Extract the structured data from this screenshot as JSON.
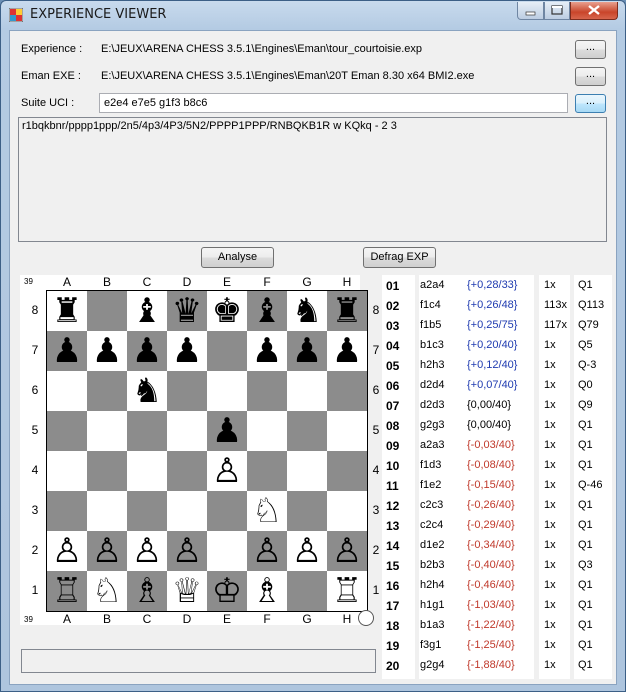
{
  "window": {
    "title": "EXPERIENCE VIEWER"
  },
  "form": {
    "experience_label": "Experience :",
    "experience_path": "E:\\JEUX\\ARENA CHESS 3.5.1\\Engines\\Eman\\tour_courtoisie.exp",
    "eman_label": "Eman EXE :",
    "eman_path": "E:\\JEUX\\ARENA CHESS 3.5.1\\Engines\\Eman\\20T Eman 8.30 x64 BMI2.exe",
    "uci_label": "Suite UCI :",
    "uci_value": "e2e4 e7e5 g1f3 b8c6",
    "browse_label": "...",
    "fen": "r1bqkbnr/pppp1ppp/2n5/4p3/4P3/5N2/PPPP1PPP/RNBQKB1R w KQkq - 2 3"
  },
  "buttons": {
    "analyse": "Analyse",
    "defrag": "Defrag EXP"
  },
  "board": {
    "files": [
      "A",
      "B",
      "C",
      "D",
      "E",
      "F",
      "G",
      "H"
    ],
    "ranks": [
      "8",
      "7",
      "6",
      "5",
      "4",
      "3",
      "2",
      "1"
    ],
    "corner_label": "39",
    "position": [
      [
        "r",
        "",
        "b",
        "q",
        "k",
        "b",
        "n",
        "r"
      ],
      [
        "p",
        "p",
        "p",
        "p",
        "",
        "p",
        "p",
        "p"
      ],
      [
        "",
        "",
        "n",
        "",
        "",
        "",
        "",
        ""
      ],
      [
        "",
        "",
        "",
        "",
        "p",
        "",
        "",
        ""
      ],
      [
        "",
        "",
        "",
        "",
        "P",
        "",
        "",
        ""
      ],
      [
        "",
        "",
        "",
        "",
        "",
        "N",
        "",
        ""
      ],
      [
        "P",
        "P",
        "P",
        "P",
        "",
        "P",
        "P",
        "P"
      ],
      [
        "R",
        "N",
        "B",
        "Q",
        "K",
        "B",
        "",
        "R"
      ]
    ]
  },
  "colors": {
    "positive": "#1f3bb0",
    "neutral": "#000000",
    "negative": "#c0392b",
    "dark_square": "#8c8c8c"
  },
  "moves": [
    {
      "num": "01",
      "move": "a2a4",
      "eval": "{+0,28/33}",
      "tone": "positive",
      "count": "1x",
      "q": "Q1"
    },
    {
      "num": "02",
      "move": "f1c4",
      "eval": "{+0,26/48}",
      "tone": "positive",
      "count": "113x",
      "q": "Q113"
    },
    {
      "num": "03",
      "move": "f1b5",
      "eval": "{+0,25/75}",
      "tone": "positive",
      "count": "117x",
      "q": "Q79"
    },
    {
      "num": "04",
      "move": "b1c3",
      "eval": "{+0,20/40}",
      "tone": "positive",
      "count": "1x",
      "q": "Q5"
    },
    {
      "num": "05",
      "move": "h2h3",
      "eval": "{+0,12/40}",
      "tone": "positive",
      "count": "1x",
      "q": "Q-3"
    },
    {
      "num": "06",
      "move": "d2d4",
      "eval": "{+0,07/40}",
      "tone": "positive",
      "count": "1x",
      "q": "Q0"
    },
    {
      "num": "07",
      "move": "d2d3",
      "eval": "{0,00/40}",
      "tone": "neutral",
      "count": "1x",
      "q": "Q9"
    },
    {
      "num": "08",
      "move": "g2g3",
      "eval": "{0,00/40}",
      "tone": "neutral",
      "count": "1x",
      "q": "Q1"
    },
    {
      "num": "09",
      "move": "a2a3",
      "eval": "{-0,03/40}",
      "tone": "negative",
      "count": "1x",
      "q": "Q1"
    },
    {
      "num": "10",
      "move": "f1d3",
      "eval": "{-0,08/40}",
      "tone": "negative",
      "count": "1x",
      "q": "Q1"
    },
    {
      "num": "11",
      "move": "f1e2",
      "eval": "{-0,15/40}",
      "tone": "negative",
      "count": "1x",
      "q": "Q-46"
    },
    {
      "num": "12",
      "move": "c2c3",
      "eval": "{-0,26/40}",
      "tone": "negative",
      "count": "1x",
      "q": "Q1"
    },
    {
      "num": "13",
      "move": "c2c4",
      "eval": "{-0,29/40}",
      "tone": "negative",
      "count": "1x",
      "q": "Q1"
    },
    {
      "num": "14",
      "move": "d1e2",
      "eval": "{-0,34/40}",
      "tone": "negative",
      "count": "1x",
      "q": "Q1"
    },
    {
      "num": "15",
      "move": "b2b3",
      "eval": "{-0,40/40}",
      "tone": "negative",
      "count": "1x",
      "q": "Q3"
    },
    {
      "num": "16",
      "move": "h2h4",
      "eval": "{-0,46/40}",
      "tone": "negative",
      "count": "1x",
      "q": "Q1"
    },
    {
      "num": "17",
      "move": "h1g1",
      "eval": "{-1,03/40}",
      "tone": "negative",
      "count": "1x",
      "q": "Q1"
    },
    {
      "num": "18",
      "move": "b1a3",
      "eval": "{-1,22/40}",
      "tone": "negative",
      "count": "1x",
      "q": "Q1"
    },
    {
      "num": "19",
      "move": "f3g1",
      "eval": "{-1,25/40}",
      "tone": "negative",
      "count": "1x",
      "q": "Q1"
    },
    {
      "num": "20",
      "move": "g2g4",
      "eval": "{-1,88/40}",
      "tone": "negative",
      "count": "1x",
      "q": "Q1"
    }
  ]
}
